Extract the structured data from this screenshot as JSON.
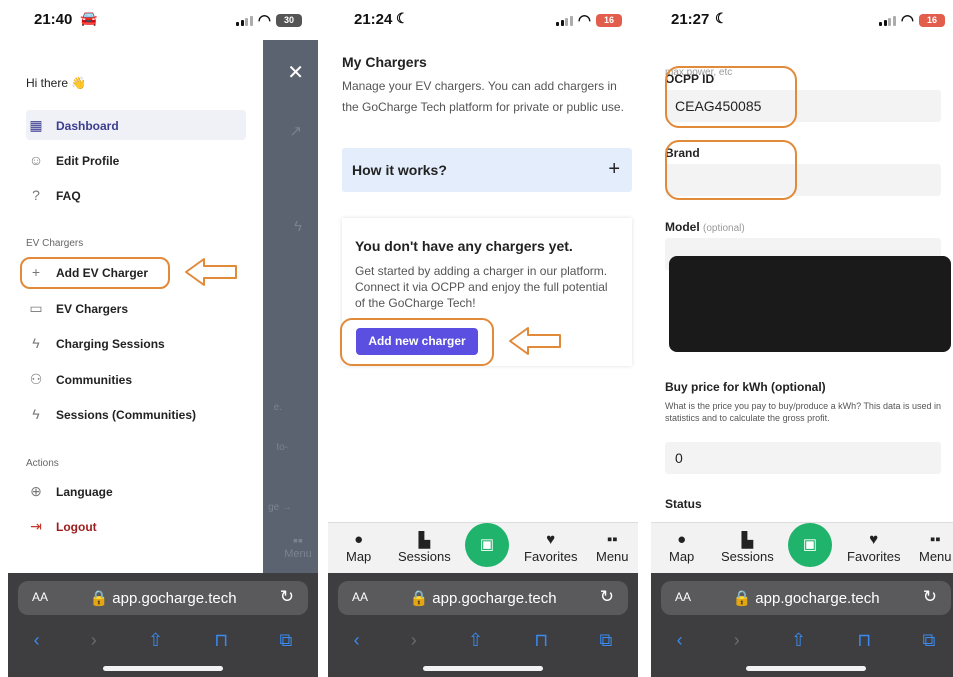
{
  "panel1": {
    "time": "21:40",
    "battery": "30",
    "greeting": "Hi there 👋",
    "menu": [
      {
        "label": "Dashboard",
        "icon": "dashboard-icon",
        "glyph": "▦"
      },
      {
        "label": "Edit Profile",
        "icon": "user-icon",
        "glyph": "☺"
      },
      {
        "label": "FAQ",
        "icon": "question-icon",
        "glyph": "?"
      }
    ],
    "section_ev": "EV Chargers",
    "ev_menu": [
      {
        "label": "Add EV Charger",
        "icon": "plus-icon",
        "glyph": "+"
      },
      {
        "label": "EV Chargers",
        "icon": "charger-icon",
        "glyph": "▭"
      },
      {
        "label": "Charging Sessions",
        "icon": "lightning-icon",
        "glyph": "ϟ"
      },
      {
        "label": "Communities",
        "icon": "community-icon",
        "glyph": "⚇"
      },
      {
        "label": "Sessions (Communities)",
        "icon": "lightning-icon",
        "glyph": "ϟ"
      }
    ],
    "section_actions": "Actions",
    "actions": [
      {
        "label": "Language",
        "icon": "globe-icon",
        "glyph": "⊕"
      },
      {
        "label": "Logout",
        "icon": "logout-icon",
        "glyph": "⇥"
      }
    ],
    "scrim_fragments": [
      "↗",
      "ϟ",
      "e.",
      "to-",
      "ge →"
    ],
    "menu_label": "Menu",
    "url": "app.gocharge.tech"
  },
  "panel2": {
    "time": "21:24",
    "battery": "16",
    "title": "My Chargers",
    "description": "Manage your EV chargers. You can add chargers in the GoCharge Tech platform for private or public use.",
    "how_it_works": "How it works?",
    "empty_title": "You don't have any chargers yet.",
    "empty_desc": "Get started by adding a charger in our platform. Connect it via OCPP and enjoy the full potential of the GoCharge Tech!",
    "add_button": "Add new charger",
    "url": "app.gocharge.tech"
  },
  "panel3": {
    "time": "21:27",
    "battery": "16",
    "cut_text": "max power, etc",
    "ocpp_label": "OCPP ID",
    "ocpp_value": "CEAG450085",
    "brand_label": "Brand",
    "brand_value": "",
    "model_label": "Model",
    "model_optional": "(optional)",
    "buy_label": "Buy price for kWh (optional)",
    "buy_help": "What is the price you pay to buy/produce a kWh? This data is used in statistics and to calculate the gross profit.",
    "buy_value": "0",
    "status_label": "Status",
    "url": "app.gocharge.tech"
  },
  "bottom_nav": [
    "Map",
    "Sessions",
    "Favorites",
    "Menu"
  ],
  "safari": {
    "aa": "AA"
  },
  "colors": {
    "accent": "#5a4fe0",
    "highlight": "#e08a3a",
    "qr_green": "#1fb36b",
    "logout": "#9b1c1c"
  }
}
